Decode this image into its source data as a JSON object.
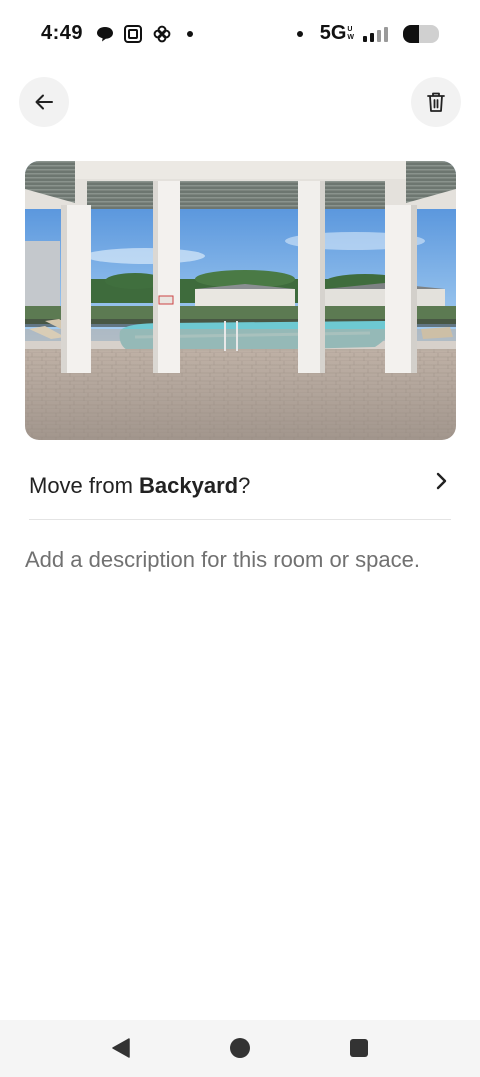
{
  "status_bar": {
    "time": "4:49",
    "network": "5G",
    "network_sup_top": "U",
    "network_sup_bottom": "W",
    "icons": [
      "message-icon",
      "screen-icon",
      "pinwheel-icon",
      "notification-dot",
      "signal-icon",
      "battery-icon"
    ]
  },
  "header": {
    "back_icon": "arrow-left-icon",
    "delete_icon": "trash-icon"
  },
  "photo": {
    "subject": "pool-pavilion"
  },
  "move_row": {
    "prefix": "Move from ",
    "room": "Backyard",
    "suffix": "?"
  },
  "description": {
    "placeholder": "Add a description for this room or space."
  },
  "nav_bar": {
    "icons": [
      "back-triangle-icon",
      "home-circle-icon",
      "recents-square-icon"
    ]
  },
  "colors": {
    "text_primary": "#222222",
    "text_secondary": "#717171",
    "button_bg": "#f2f2f2",
    "divider": "#e4e4e4"
  }
}
